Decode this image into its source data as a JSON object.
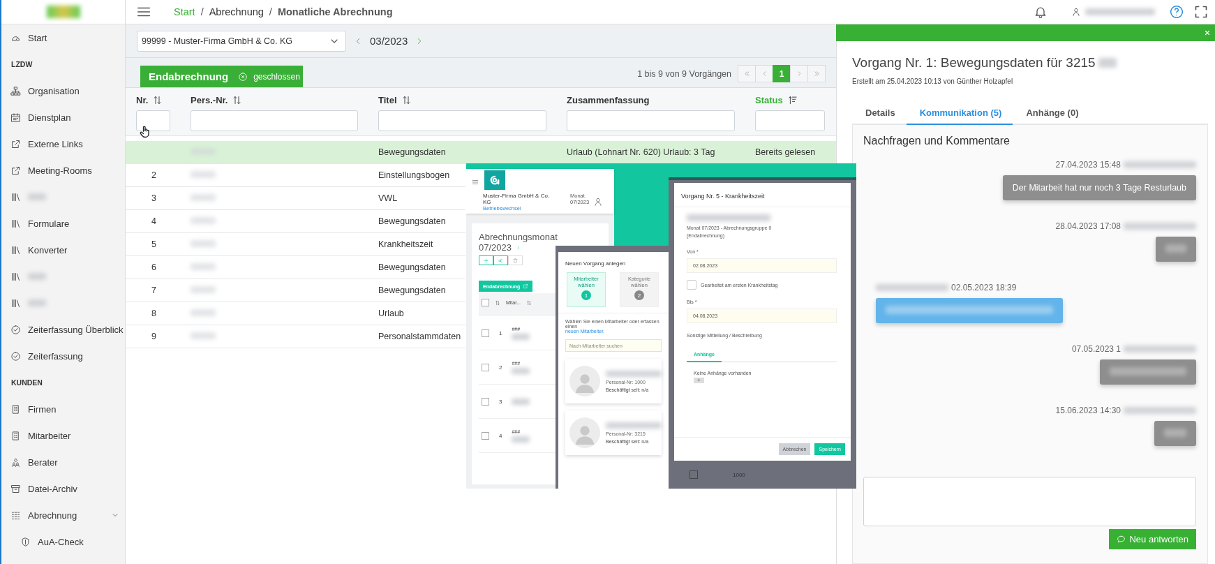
{
  "header": {
    "separator": "/",
    "breadcrumb": [
      {
        "label": "Start",
        "kind": "link"
      },
      {
        "label": "Abrechnung",
        "kind": "link"
      },
      {
        "label": "Monatliche Abrechnung",
        "kind": "current"
      }
    ]
  },
  "sidebar": {
    "items": [
      {
        "kind": "link",
        "label": "Start"
      },
      {
        "kind": "section",
        "label": "LZDW"
      },
      {
        "kind": "link",
        "label": "Organisation"
      },
      {
        "kind": "link",
        "label": "Dienstplan"
      },
      {
        "kind": "link",
        "label": "Externe Links"
      },
      {
        "kind": "link",
        "label": "Meeting-Rooms"
      },
      {
        "kind": "link"
      },
      {
        "kind": "link",
        "label": "Formulare"
      },
      {
        "kind": "link",
        "label": "Konverter"
      },
      {
        "kind": "link"
      },
      {
        "kind": "link"
      },
      {
        "kind": "link",
        "label": "Zeiterfassung Überblick"
      },
      {
        "kind": "link",
        "label": "Zeiterfassung"
      },
      {
        "kind": "section",
        "label": "KUNDEN"
      },
      {
        "kind": "link",
        "label": "Firmen"
      },
      {
        "kind": "link",
        "label": "Mitarbeiter"
      },
      {
        "kind": "link",
        "label": "Berater"
      },
      {
        "kind": "link",
        "label": "Datei-Archiv"
      },
      {
        "kind": "group",
        "label": "Abrechnung",
        "expanded": true,
        "children": [
          {
            "kind": "link",
            "label": "AuA-Check"
          }
        ]
      }
    ]
  },
  "filter_bar": {
    "company": "99999 - Muster-Firma GmbH & Co. KG",
    "period": "03/2023"
  },
  "list_header": {
    "status_button": {
      "label": "Endabrechnung",
      "status": "geschlossen",
      "closed": true
    },
    "range_text": "1 bis 9 von 9 Vorgängen",
    "pages": [
      {
        "label": "1",
        "selected": true
      }
    ]
  },
  "table": {
    "columns": [
      {
        "label": "Nr.",
        "sortable": true,
        "sorted": false
      },
      {
        "label": "Pers.-Nr.",
        "sortable": true,
        "sorted": false
      },
      {
        "label": "Titel",
        "sortable": true,
        "sorted": false
      },
      {
        "label": "Zusammenfassung",
        "sortable": false,
        "sorted": false
      },
      {
        "label": "Status",
        "sortable": true,
        "sorted": true
      }
    ],
    "rows": [
      {
        "selected": true,
        "title": "Bewegungsdaten",
        "summary": "Urlaub (Lohnart Nr. 620) Urlaub: 3 Tag",
        "status": "Bereits gelesen"
      },
      {
        "selected": false,
        "nr": "2",
        "title": "Einstellungsbogen"
      },
      {
        "selected": false,
        "nr": "3",
        "title": "VWL"
      },
      {
        "selected": false,
        "nr": "4",
        "title": "Bewegungsdaten"
      },
      {
        "selected": false,
        "nr": "5",
        "title": "Krankheitszeit"
      },
      {
        "selected": false,
        "nr": "6",
        "title": "Bewegungsdaten"
      },
      {
        "selected": false,
        "nr": "7",
        "title": "Bewegungsdaten"
      },
      {
        "selected": false,
        "nr": "8",
        "title": "Urlaub"
      },
      {
        "selected": false,
        "nr": "9",
        "title": "Personalstammdaten"
      }
    ]
  },
  "detail_panel": {
    "title": "Vorgang Nr. 1: Bewegungsdaten für 3215",
    "subtitle": "Erstellt am 25.04.2023 10:13 von Günther Holzapfel",
    "tabs": [
      {
        "label": "Details",
        "selected": false
      },
      {
        "label": "Kommunikation (5)",
        "selected": true
      },
      {
        "label": "Anhänge (0)",
        "selected": false
      }
    ],
    "heading": "Nachfragen und Kommentare",
    "messages": [
      {
        "kind": "sent",
        "time": "27.04.2023 15:48",
        "text": "Der Mitarbeit hat nur noch 3 Tage Resturlaub"
      },
      {
        "kind": "sent",
        "time": "28.04.2023 17:08"
      },
      {
        "kind": "received",
        "time": "02.05.2023 18:39"
      },
      {
        "kind": "sent",
        "time": "07.05.2023 1"
      },
      {
        "kind": "sent",
        "time": "15.06.2023 14:30"
      }
    ],
    "reply_button": "Neu antworten"
  },
  "embedded_screenshot": {
    "app_window": {
      "company": "Muster-Firma GmbH & Co. KG",
      "company_link": "Betriebswechsel",
      "month_label": "Monat",
      "month": "07/2023",
      "page_title": "Abrechnungsmonat",
      "page_month": "07/2023",
      "final_button": "Endabrechnung",
      "column_2": "Mitar...",
      "all_checked": false,
      "rows": [
        {
          "nr": "1",
          "value": "###",
          "checked": false
        },
        {
          "nr": "2",
          "value": "###",
          "checked": false
        },
        {
          "nr": "3",
          "checked": false
        },
        {
          "nr": "4",
          "value": "###",
          "checked": false
        }
      ]
    },
    "new_dialog": {
      "title": "Neuen Vorgang anlegen",
      "steps": [
        {
          "label": "Mitarbeiter wählen",
          "number": "1",
          "selected": true
        },
        {
          "label": "Kategorie wählen",
          "number": "2",
          "selected": false
        }
      ],
      "hint": "Wählen Sie einen Mitarbeiter oder erfassen einen",
      "link": "neuen Mitarbeiter.",
      "search_placeholder": "Nach Mitarbeiter suchen",
      "employees": [
        {
          "personal_nr": "Personal-Nr: 1000",
          "since": "Beschäftigt seit: n/a"
        },
        {
          "personal_nr": "Personal-Nr: 3215",
          "since": "Beschäftigt seit: n/a"
        }
      ]
    },
    "case_dialog": {
      "title": "Vorgang Nr. 5 - Krankheitszeit",
      "subtitle": "Monat 07/2023 - Abrechnungsgruppe 0 (Endabrechnung)",
      "from_label": "Von *",
      "from_value": "02.08.2023",
      "checkbox": {
        "label": "Gearbeitet am ersten Krankheitstag",
        "checked": false
      },
      "to_label": "Bis *",
      "to_value": "04.08.2023",
      "message_label": "Sonstige Mitteilung / Beschreibung",
      "tab": "Anhänge",
      "empty_text": "Keine Anhänge vorhanden",
      "add_button": "+",
      "buttons": [
        "Abbrechen",
        "Speichern"
      ],
      "background_cell": "1000",
      "background_checked": false
    }
  }
}
